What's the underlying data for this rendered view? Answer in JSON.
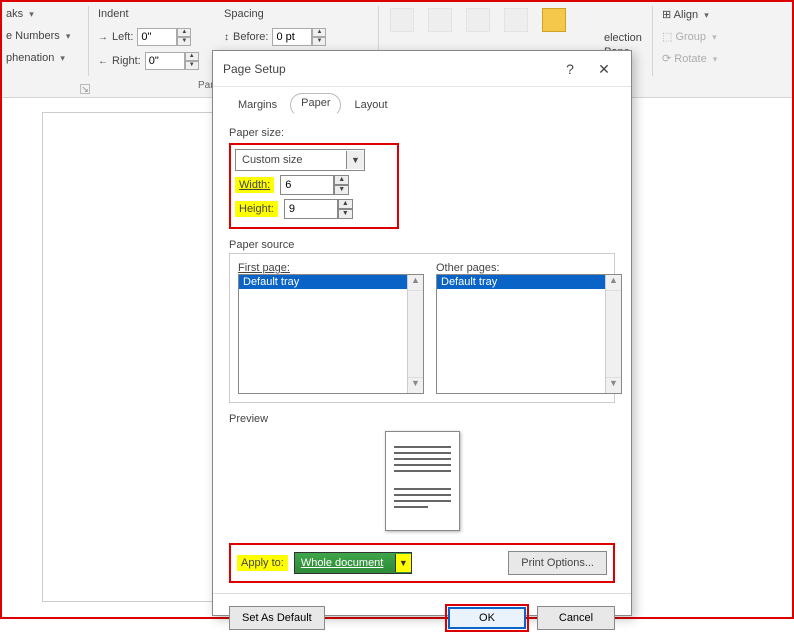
{
  "ribbon": {
    "breaks": "aks",
    "line_numbers": "e Numbers",
    "hyphenation": "phenation",
    "indent_label": "Indent",
    "left_label": "Left:",
    "right_label": "Right:",
    "left_val": "0\"",
    "right_val": "0\"",
    "spacing_label": "Spacing",
    "before_label": "Before:",
    "before_val": "0 pt",
    "group_paragraph": "Par",
    "align": "Align",
    "group_btn": "Group",
    "rotate": "Rotate",
    "selection": "election",
    "pane": "Pane"
  },
  "dialog": {
    "title": "Page Setup",
    "tabs": {
      "margins": "Margins",
      "paper": "Paper",
      "layout": "Layout"
    },
    "paper_size_label": "Paper size:",
    "paper_size_value": "Custom size",
    "width_label": "Width:",
    "width_value": "6",
    "height_label": "Height:",
    "height_value": "9",
    "paper_source_label": "Paper source",
    "first_page_label": "First page:",
    "other_pages_label": "Other pages:",
    "tray": "Default tray",
    "preview_label": "Preview",
    "apply_to_label": "Apply to:",
    "apply_to_value": "Whole document",
    "print_options": "Print Options...",
    "set_default": "Set As Default",
    "ok": "OK",
    "cancel": "Cancel"
  }
}
